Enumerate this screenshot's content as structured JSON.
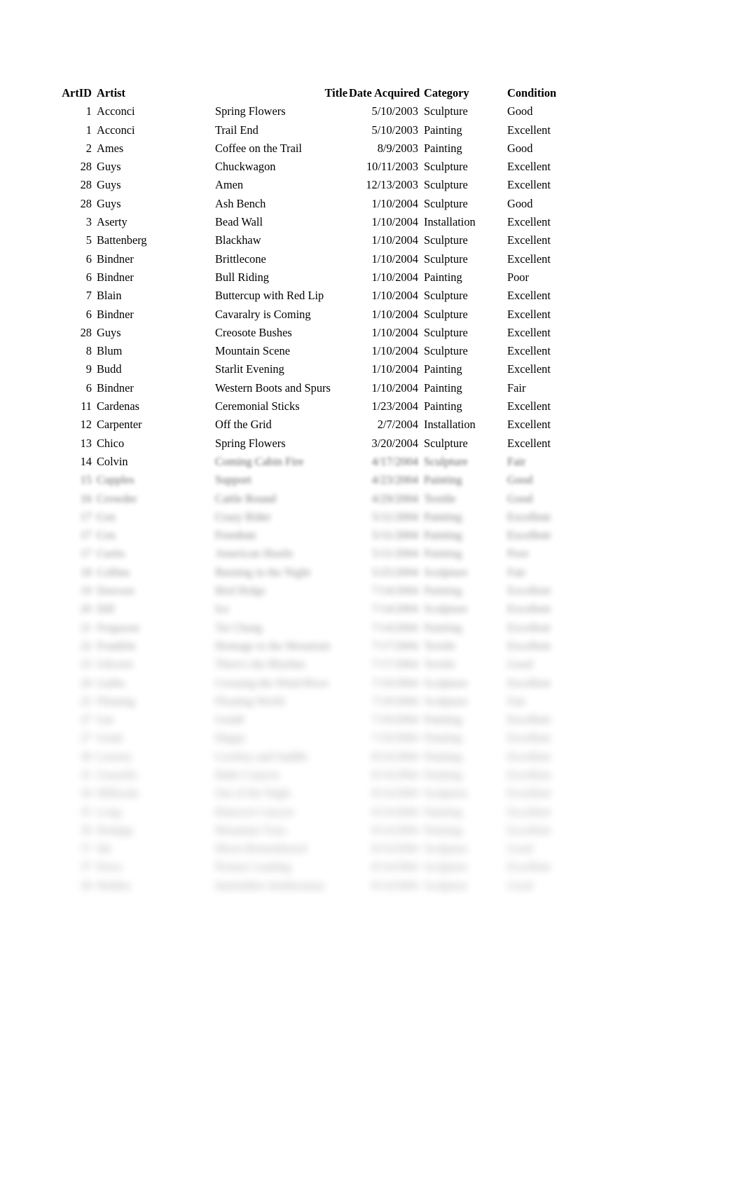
{
  "document": {
    "type": "tabular-report",
    "page_background": "#ffffff",
    "text_color": "#000000"
  },
  "table": {
    "columns": [
      {
        "key": "artid",
        "header": "ArtID",
        "align": "right"
      },
      {
        "key": "artist",
        "header": "Artist",
        "align": "left"
      },
      {
        "key": "title",
        "header": "Title",
        "align": "left"
      },
      {
        "key": "date",
        "header": "Date Acquired",
        "align": "right"
      },
      {
        "key": "category",
        "header": "Category",
        "align": "left"
      },
      {
        "key": "condition",
        "header": "Condition",
        "align": "left"
      }
    ],
    "rows": [
      {
        "artid": "1",
        "artist": "Acconci",
        "title": "Spring Flowers",
        "date": "5/10/2003",
        "category": "Sculpture",
        "condition": "Good",
        "blur": 0
      },
      {
        "artid": "1",
        "artist": "Acconci",
        "title": "Trail End",
        "date": "5/10/2003",
        "category": "Painting",
        "condition": "Excellent",
        "blur": 0
      },
      {
        "artid": "2",
        "artist": "Ames",
        "title": "Coffee on the Trail",
        "date": "8/9/2003",
        "category": "Painting",
        "condition": "Good",
        "blur": 0
      },
      {
        "artid": "28",
        "artist": "Guys",
        "title": "Chuckwagon",
        "date": "10/11/2003",
        "category": "Sculpture",
        "condition": "Excellent",
        "blur": 0
      },
      {
        "artid": "28",
        "artist": "Guys",
        "title": "Amen",
        "date": "12/13/2003",
        "category": "Sculpture",
        "condition": "Excellent",
        "blur": 0
      },
      {
        "artid": "28",
        "artist": "Guys",
        "title": "Ash Bench",
        "date": "1/10/2004",
        "category": "Sculpture",
        "condition": "Good",
        "blur": 0
      },
      {
        "artid": "3",
        "artist": "Aserty",
        "title": "Bead Wall",
        "date": "1/10/2004",
        "category": "Installation",
        "condition": "Excellent",
        "blur": 0
      },
      {
        "artid": "5",
        "artist": "Battenberg",
        "title": "Blackhaw",
        "date": "1/10/2004",
        "category": "Sculpture",
        "condition": "Excellent",
        "blur": 0
      },
      {
        "artid": "6",
        "artist": "Bindner",
        "title": "Brittlecone",
        "date": "1/10/2004",
        "category": "Sculpture",
        "condition": "Excellent",
        "blur": 0
      },
      {
        "artid": "6",
        "artist": "Bindner",
        "title": "Bull Riding",
        "date": "1/10/2004",
        "category": "Painting",
        "condition": "Poor",
        "blur": 0
      },
      {
        "artid": "7",
        "artist": "Blain",
        "title": "Buttercup with Red Lip",
        "date": "1/10/2004",
        "category": "Sculpture",
        "condition": "Excellent",
        "blur": 0
      },
      {
        "artid": "6",
        "artist": "Bindner",
        "title": "Cavaralry is Coming",
        "date": "1/10/2004",
        "category": "Sculpture",
        "condition": "Excellent",
        "blur": 0
      },
      {
        "artid": "28",
        "artist": "Guys",
        "title": "Creosote Bushes",
        "date": "1/10/2004",
        "category": "Sculpture",
        "condition": "Excellent",
        "blur": 0
      },
      {
        "artid": "8",
        "artist": "Blum",
        "title": "Mountain Scene",
        "date": "1/10/2004",
        "category": "Sculpture",
        "condition": "Excellent",
        "blur": 0
      },
      {
        "artid": "9",
        "artist": "Budd",
        "title": "Starlit Evening",
        "date": "1/10/2004",
        "category": "Painting",
        "condition": "Excellent",
        "blur": 0
      },
      {
        "artid": "6",
        "artist": "Bindner",
        "title": "Western Boots and Spurs",
        "date": "1/10/2004",
        "category": "Painting",
        "condition": "Fair",
        "blur": 0
      },
      {
        "artid": "11",
        "artist": "Cardenas",
        "title": "Ceremonial Sticks",
        "date": "1/23/2004",
        "category": "Painting",
        "condition": "Excellent",
        "blur": 0
      },
      {
        "artid": "12",
        "artist": "Carpenter",
        "title": "Off the Grid",
        "date": "2/7/2004",
        "category": "Installation",
        "condition": "Excellent",
        "blur": 0
      },
      {
        "artid": "13",
        "artist": "Chico",
        "title": "Spring Flowers",
        "date": "3/20/2004",
        "category": "Sculpture",
        "condition": "Excellent",
        "blur": 0
      },
      {
        "artid": "14",
        "artist": "Colvin",
        "title": "Coming Cabin Fire",
        "date": "4/17/2004",
        "category": "Sculpture",
        "condition": "Fair",
        "blur": "partial"
      },
      {
        "artid": "15",
        "artist": "Cupples",
        "title": "Support",
        "date": "4/23/2004",
        "category": "Painting",
        "condition": "Good",
        "blur": 1
      },
      {
        "artid": "16",
        "artist": "Crowder",
        "title": "Cattle Round",
        "date": "4/29/2004",
        "category": "Textile",
        "condition": "Good",
        "blur": 2
      },
      {
        "artid": "17",
        "artist": "Cox",
        "title": "Crazy Rider",
        "date": "5/11/2004",
        "category": "Painting",
        "condition": "Excellent",
        "blur": 3
      },
      {
        "artid": "17",
        "artist": "Cox",
        "title": "Freedom",
        "date": "5/11/2004",
        "category": "Painting",
        "condition": "Excellent",
        "blur": 3
      },
      {
        "artid": "17",
        "artist": "Curtis",
        "title": "American Hustle",
        "date": "5/11/2004",
        "category": "Painting",
        "condition": "Poor",
        "blur": 4
      },
      {
        "artid": "18",
        "artist": "Collins",
        "title": "Burning in the Night",
        "date": "5/25/2004",
        "category": "Sculpture",
        "condition": "Fair",
        "blur": 4
      },
      {
        "artid": "19",
        "artist": "Dawson",
        "title": "Bird Ridge",
        "date": "7/14/2004",
        "category": "Painting",
        "condition": "Excellent",
        "blur": 5
      },
      {
        "artid": "20",
        "artist": "Dill",
        "title": "Ice",
        "date": "7/14/2004",
        "category": "Sculpture",
        "condition": "Excellent",
        "blur": 5
      },
      {
        "artid": "21",
        "artist": "Ferguson",
        "title": "Tai Chang",
        "date": "7/14/2004",
        "category": "Painting",
        "condition": "Excellent",
        "blur": 6
      },
      {
        "artid": "22",
        "artist": "Franklin",
        "title": "Homage to the Mountain",
        "date": "7/17/2004",
        "category": "Textile",
        "condition": "Excellent",
        "blur": 6
      },
      {
        "artid": "23",
        "artist": "Gilcrest",
        "title": "There's the Rhythm",
        "date": "7/17/2004",
        "category": "Textile",
        "condition": "Good",
        "blur": 7
      },
      {
        "artid": "24",
        "artist": "Garbo",
        "title": "Crossing the Wind River",
        "date": "7/19/2004",
        "category": "Sculpture",
        "condition": "Excellent",
        "blur": 7
      },
      {
        "artid": "25",
        "artist": "Fleming",
        "title": "Floating World",
        "date": "7/19/2004",
        "category": "Sculpture",
        "condition": "Fair",
        "blur": 8
      },
      {
        "artid": "27",
        "artist": "Gat",
        "title": "Gould",
        "date": "7/19/2004",
        "category": "Painting",
        "condition": "Excellent",
        "blur": 8
      },
      {
        "artid": "27",
        "artist": "Grant",
        "title": "Happy",
        "date": "7/19/2004",
        "category": "Painting",
        "condition": "Excellent",
        "blur": 9
      },
      {
        "artid": "30",
        "artist": "Lowery",
        "title": "Cowboy and Saddle",
        "date": "8/14/2004",
        "category": "Painting",
        "condition": "Excellent",
        "blur": 9
      },
      {
        "artid": "31",
        "artist": "Gosselin",
        "title": "Rider Canyon",
        "date": "8/14/2004",
        "category": "Painting",
        "condition": "Excellent",
        "blur": 10
      },
      {
        "artid": "34",
        "artist": "Millwain",
        "title": "Out of the Night",
        "date": "8/14/2004",
        "category": "Sculpture",
        "condition": "Excellent",
        "blur": 10
      },
      {
        "artid": "35",
        "artist": "Long",
        "title": "Rimrock Canyon",
        "date": "8/14/2004",
        "category": "Painting",
        "condition": "Excellent",
        "blur": 11
      },
      {
        "artid": "36",
        "artist": "Hodapp",
        "title": "Mountain Vista",
        "date": "8/14/2004",
        "category": "Painting",
        "condition": "Excellent",
        "blur": 11
      },
      {
        "artid": "37",
        "artist": "Ide",
        "title": "Moon Remembered",
        "date": "8/14/2004",
        "category": "Sculpture",
        "condition": "Good",
        "blur": 11
      },
      {
        "artid": "37",
        "artist": "Perez",
        "title": "Pioneer Landing",
        "date": "8/14/2004",
        "category": "Sculpture",
        "condition": "Excellent",
        "blur": 11
      },
      {
        "artid": "38",
        "artist": "Holden",
        "title": "Innisfallen Smithsonian",
        "date": "8/14/2004",
        "category": "Sculpture",
        "condition": "Good",
        "blur": 11
      }
    ]
  }
}
